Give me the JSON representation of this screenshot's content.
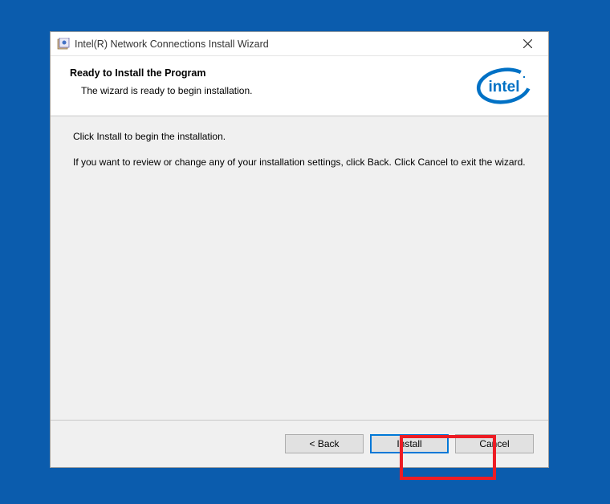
{
  "titlebar": {
    "title": "Intel(R) Network Connections Install Wizard"
  },
  "header": {
    "title": "Ready to Install the Program",
    "subtitle": "The wizard is ready to begin installation."
  },
  "content": {
    "line1": "Click Install to begin the installation.",
    "line2": "If you want to review or change any of your installation settings, click Back. Click Cancel to exit the wizard."
  },
  "footer": {
    "back_label": "< Back",
    "install_label": "Install",
    "cancel_label": "Cancel"
  },
  "logo": {
    "text": "intel"
  }
}
